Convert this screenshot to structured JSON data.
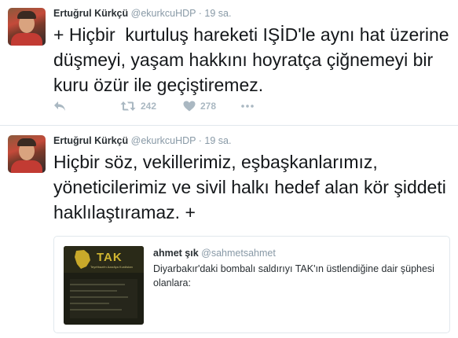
{
  "tweets": [
    {
      "author": "Ertuğrul Kürkçü",
      "handle": "@ekurkcuHDP",
      "separator": "·",
      "time": "19 sa.",
      "text": "+ Hiçbir  kurtuluş hareketi IŞİD'le aynı hat üzerine düşmeyi, yaşam hakkını hoyratça çiğnemeyi bir kuru özür ile geçiştiremez.",
      "actions": {
        "reply_icon": "reply-icon",
        "retweet_icon": "retweet-icon",
        "retweet_count": "242",
        "like_icon": "heart-icon",
        "like_count": "278",
        "more_icon": "more-icon"
      }
    },
    {
      "author": "Ertuğrul Kürkçü",
      "handle": "@ekurkcuHDP",
      "separator": "·",
      "time": "19 sa.",
      "text": "Hiçbir söz, vekillerimiz, eşbaşkanlarımız, yöneticilerimiz ve sivil halkı hedef alan kör şiddeti haklılaştıramaz. +",
      "quote": {
        "thumb_logo": "TAK",
        "thumb_caption": "Teyrêbazên Azadiya Kurdistan",
        "author": "ahmet şık",
        "handle": "@sahmetsahmet",
        "text": "Diyarbakır'daki bombalı saldırıyı TAK'ın üstlendiğine dair şüphesi olanlara:"
      }
    }
  ],
  "colors": {
    "text": "#14171a",
    "muted": "#8899a6",
    "icon": "#aab8c2",
    "border": "#e1e8ed"
  }
}
